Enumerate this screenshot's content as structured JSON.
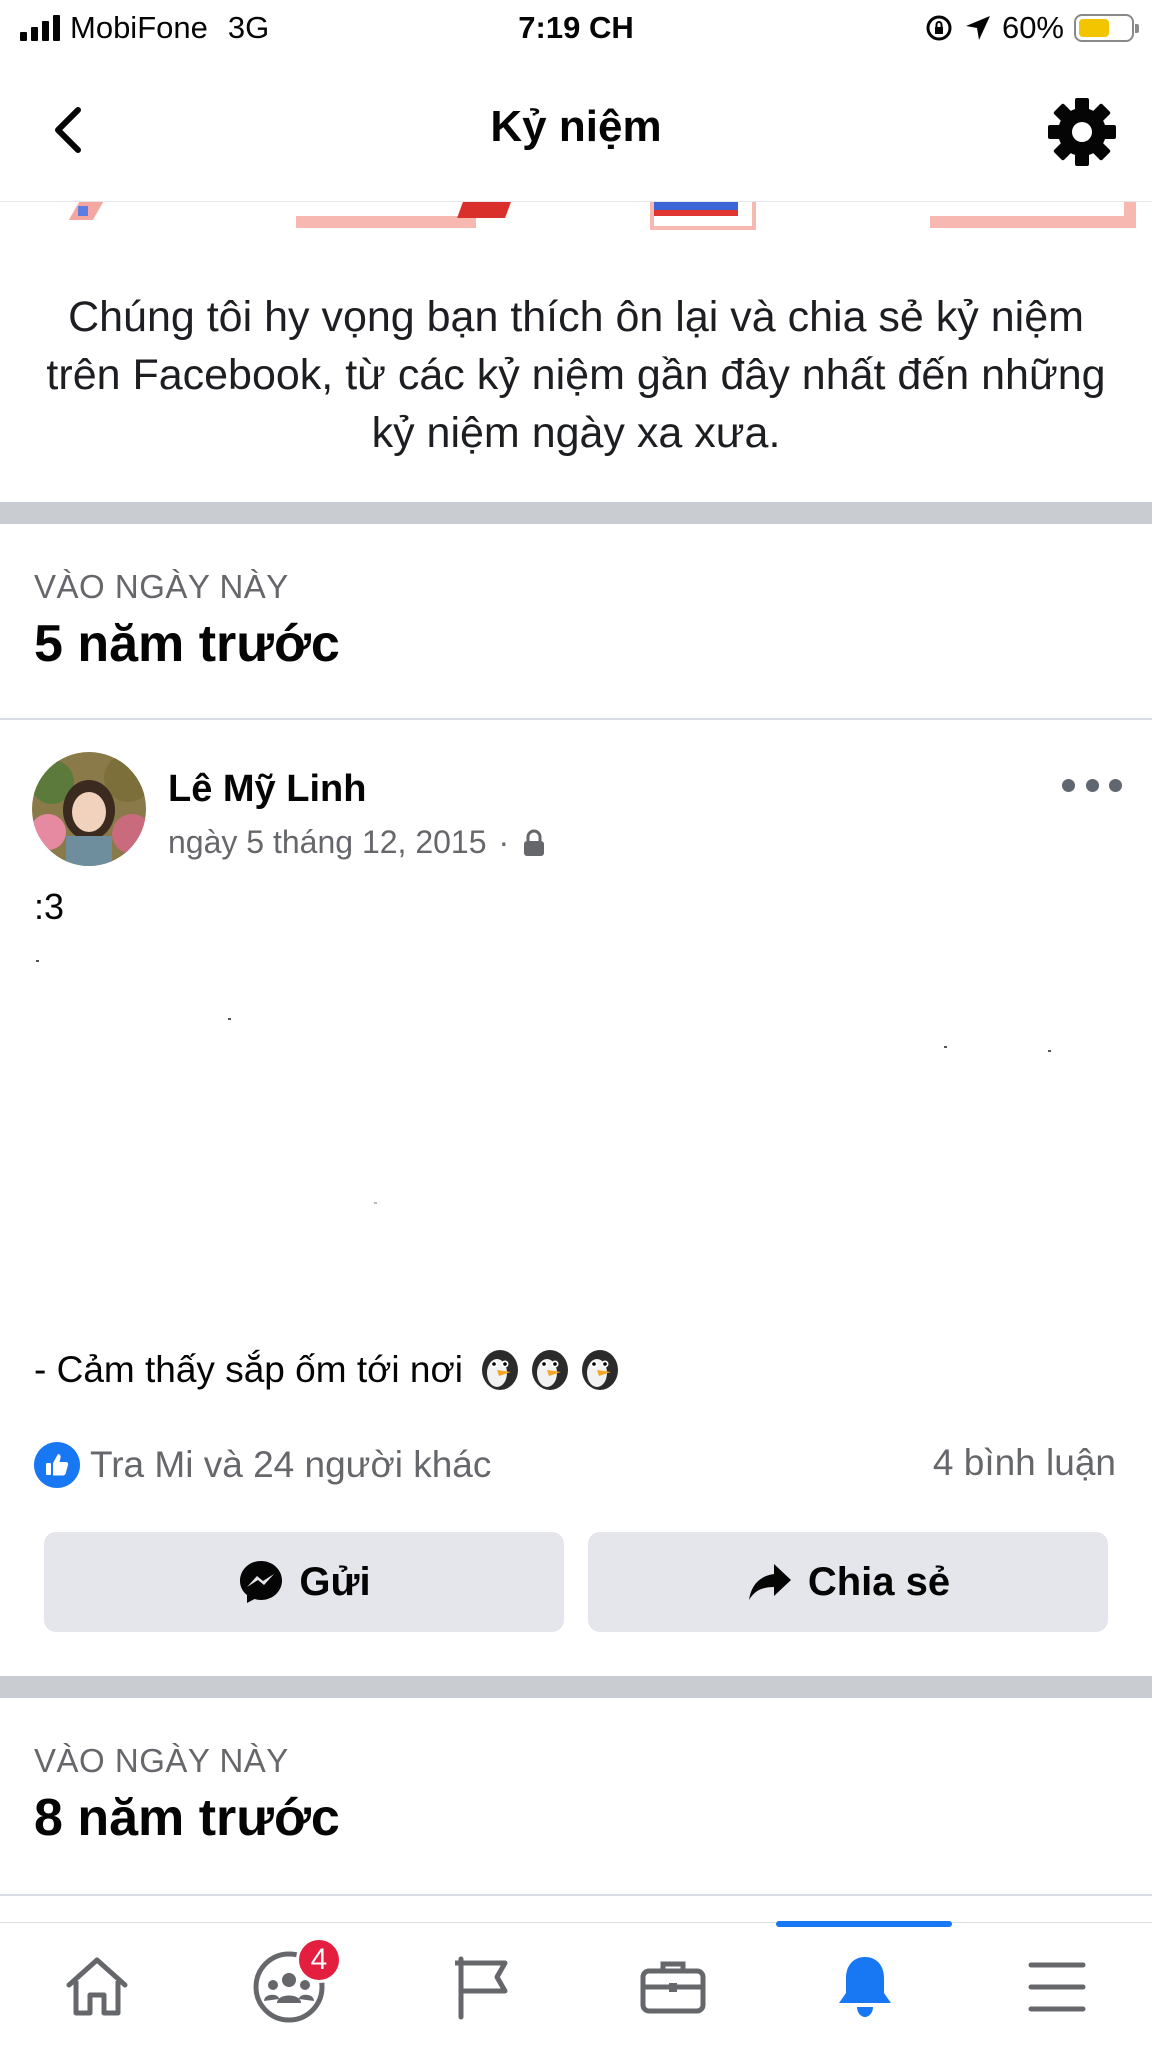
{
  "status_bar": {
    "carrier": "MobiFone",
    "network": "3G",
    "time": "7:19 CH",
    "battery_percent": "60%",
    "battery_level": 0.6,
    "battery_color": "#f2c500"
  },
  "header": {
    "title": "Kỷ niệm",
    "back_icon": "chevron-left-icon",
    "settings_icon": "gear-icon"
  },
  "intro": {
    "text": "Chúng tôi hy vọng bạn thích ôn lại và chia sẻ kỷ niệm trên Facebook, từ các kỷ niệm gần đây nhất đến những kỷ niệm ngày xa xưa."
  },
  "sections": [
    {
      "label": "VÀO NGÀY NÀY",
      "heading": "5 năm trước"
    },
    {
      "label": "VÀO NGÀY NÀY",
      "heading": "8 năm trước"
    }
  ],
  "post": {
    "author": "Lê Mỹ Linh",
    "date": "ngày 5 tháng 12, 2015",
    "separator": "·",
    "privacy_icon": "lock-icon",
    "text_line_1": ":3",
    "text_line_2": "- Cảm thấy sắp ốm tới nơi",
    "emoji_count": 3,
    "reactions_text": "Tra Mi và 24 người khác",
    "comments_text": "4 bình luận",
    "send_label": "Gửi",
    "share_label": "Chia sẻ"
  },
  "colors": {
    "accent": "#1877f2",
    "badge": "#e41e3f",
    "button_bg": "#e4e6eb",
    "divider": "#c9ccd1"
  },
  "bottom_nav": {
    "items": [
      {
        "icon": "home-icon",
        "active": false
      },
      {
        "icon": "groups-icon",
        "active": false,
        "badge": "4"
      },
      {
        "icon": "pages-flag-icon",
        "active": false
      },
      {
        "icon": "marketplace-briefcase-icon",
        "active": false
      },
      {
        "icon": "notifications-bell-icon",
        "active": true
      },
      {
        "icon": "menu-icon",
        "active": false
      }
    ]
  }
}
